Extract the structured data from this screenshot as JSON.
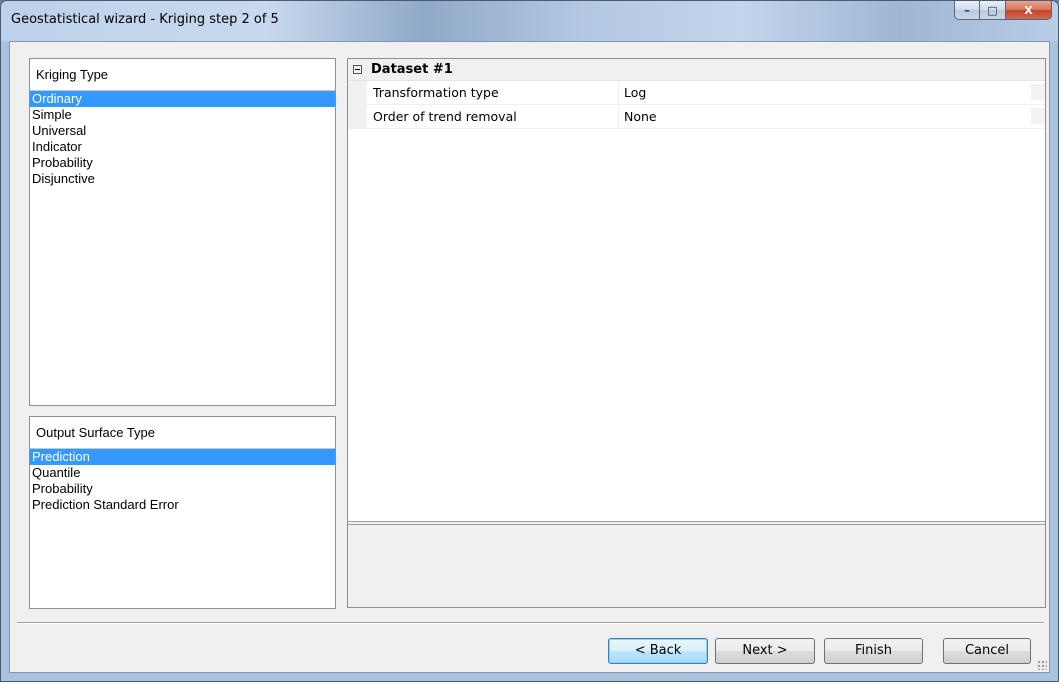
{
  "window": {
    "title": "Geostatistical wizard - Kriging step 2 of 5",
    "controls": {
      "minimize": "–",
      "maximize": "□",
      "close": "X"
    }
  },
  "kriging_type": {
    "header": "Kriging Type",
    "selected_index": 0,
    "items": [
      "Ordinary",
      "Simple",
      "Universal",
      "Indicator",
      "Probability",
      "Disjunctive"
    ]
  },
  "output_surface_type": {
    "header": "Output Surface Type",
    "selected_index": 0,
    "items": [
      "Prediction",
      "Quantile",
      "Probability",
      "Prediction Standard Error"
    ]
  },
  "properties": {
    "category": "Dataset #1",
    "rows": [
      {
        "name": "Transformation type",
        "value": "Log"
      },
      {
        "name": "Order of trend removal",
        "value": "None"
      }
    ]
  },
  "buttons": {
    "back": "< Back",
    "next": "Next >",
    "finish": "Finish",
    "cancel": "Cancel"
  }
}
